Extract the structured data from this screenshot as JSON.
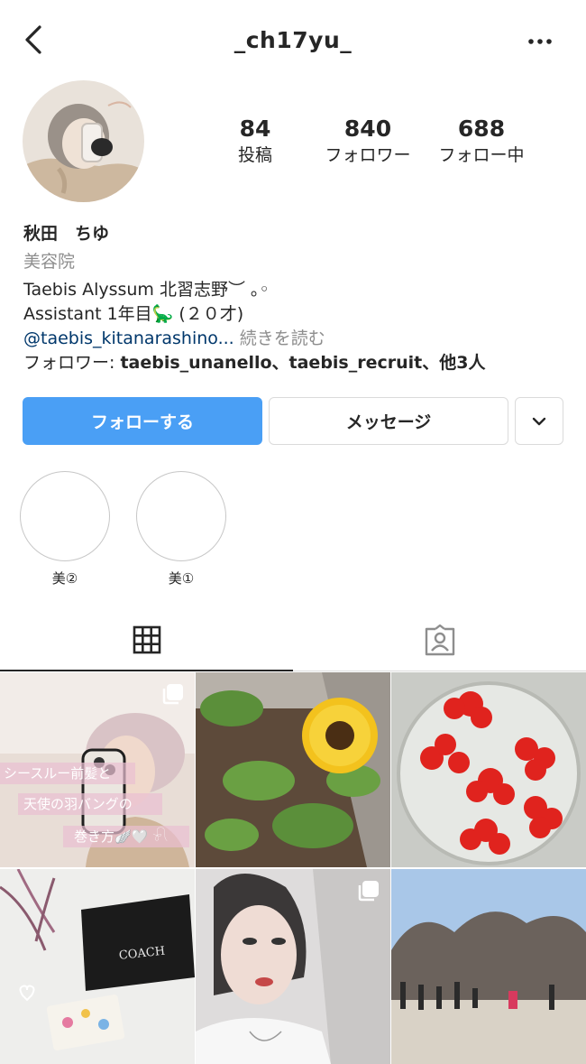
{
  "header": {
    "username": "_ch17yu_"
  },
  "stats": [
    {
      "value": "84",
      "label": "投稿"
    },
    {
      "value": "840",
      "label": "フォロワー"
    },
    {
      "value": "688",
      "label": "フォロー中"
    }
  ],
  "bio": {
    "name": "秋田　ちゆ",
    "category": "美容院",
    "line1": "Taebis Alyssum 北習志野︶ ｡◦",
    "line2": "Assistant 1年目🦕 (２０才)",
    "link": "@taebis_kitanarashino...",
    "more": " 続きを読む",
    "followed_prefix": "フォロワー: ",
    "followed_names": "taebis_unanello、taebis_recruit、他3人"
  },
  "buttons": {
    "follow": "フォローする",
    "message": "メッセージ"
  },
  "highlights": [
    {
      "label": "美②"
    },
    {
      "label": "美①"
    }
  ],
  "posts": {
    "overlay_line1": "シースルー前髪と",
    "overlay_line2": "天使の羽バングの",
    "overlay_line3": "巻き方🪽🤍 𓍯",
    "coach_text": "COACH"
  },
  "colors": {
    "accent": "#4a9ff5",
    "text": "#262626",
    "muted": "#8e8e8e",
    "link": "#00376b"
  }
}
